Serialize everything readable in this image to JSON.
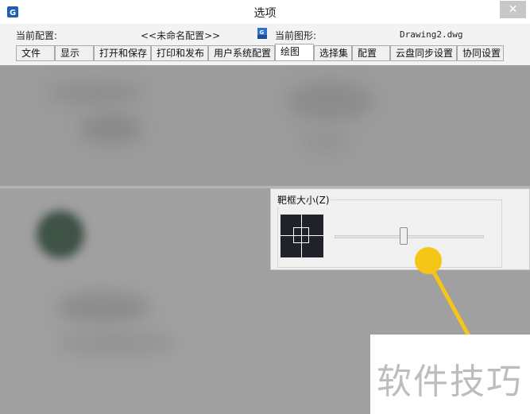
{
  "window": {
    "title": "选项",
    "close_glyph": "✕"
  },
  "header": {
    "current_profile_label": "当前配置:",
    "current_profile_value": "<<未命名配置>>",
    "current_drawing_label": "当前图形:",
    "current_drawing_value": "Drawing2.dwg"
  },
  "tabs": [
    {
      "label": "文件"
    },
    {
      "label": "显示"
    },
    {
      "label": "打开和保存"
    },
    {
      "label": "打印和发布"
    },
    {
      "label": "用户系统配置"
    },
    {
      "label": "绘图",
      "active": true
    },
    {
      "label": "选择集"
    },
    {
      "label": "配置"
    },
    {
      "label": "云盘同步设置"
    },
    {
      "label": "协同设置"
    }
  ],
  "aperture": {
    "group_label": "靶框大小(Z)",
    "slider_level": 0.46
  },
  "watermark": {
    "text": "软件技巧"
  },
  "colors": {
    "callout": "#f5c518",
    "preview_bg": "#1f2329",
    "app_icon": "#1e5fb4"
  },
  "icons": {
    "app": "app-logo-icon",
    "drawing": "drawing-file-icon",
    "close": "close-icon"
  }
}
